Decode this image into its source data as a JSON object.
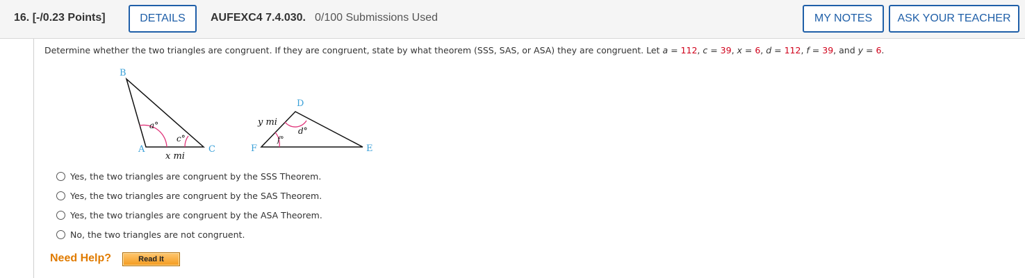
{
  "header": {
    "question_number": "16.",
    "points": "[-/0.23 Points]",
    "details_label": "DETAILS",
    "assignment_code": "AUFEXC4 7.4.030.",
    "submissions": "0/100 Submissions Used",
    "my_notes_label": "MY NOTES",
    "ask_teacher_label": "ASK YOUR TEACHER"
  },
  "prompt": {
    "text": "Determine whether the two triangles are congruent. If they are congruent, state by what theorem (SSS, SAS, or ASA) they are congruent. Let",
    "vars": [
      {
        "name": "a",
        "value": "112"
      },
      {
        "name": "c",
        "value": "39"
      },
      {
        "name": "x",
        "value": "6"
      },
      {
        "name": "d",
        "value": "112"
      },
      {
        "name": "f",
        "value": "39"
      },
      {
        "name": "y",
        "value": "6"
      }
    ],
    "and_word": "and"
  },
  "figure": {
    "triangle1": {
      "vertex_b": "B",
      "vertex_a": "A",
      "vertex_c": "C",
      "angle_a": "a°",
      "angle_c": "c°",
      "side": "x mi"
    },
    "triangle2": {
      "vertex_d": "D",
      "vertex_f": "F",
      "vertex_e": "E",
      "angle_d": "d°",
      "angle_f": "f°",
      "side": "y mi"
    },
    "label_color": "#3aa0d8",
    "arc_color": "#e0357a"
  },
  "choices": [
    "Yes, the two triangles are congruent by the SSS Theorem.",
    "Yes, the two triangles are congruent by the SAS Theorem.",
    "Yes, the two triangles are congruent by the ASA Theorem.",
    "No, the two triangles are not congruent."
  ],
  "help": {
    "need_help": "Need Help?",
    "read_it": "Read It"
  },
  "colors": {
    "accent": "#1f5fa8",
    "value_red": "#d0021b",
    "help_orange": "#e07b00"
  }
}
